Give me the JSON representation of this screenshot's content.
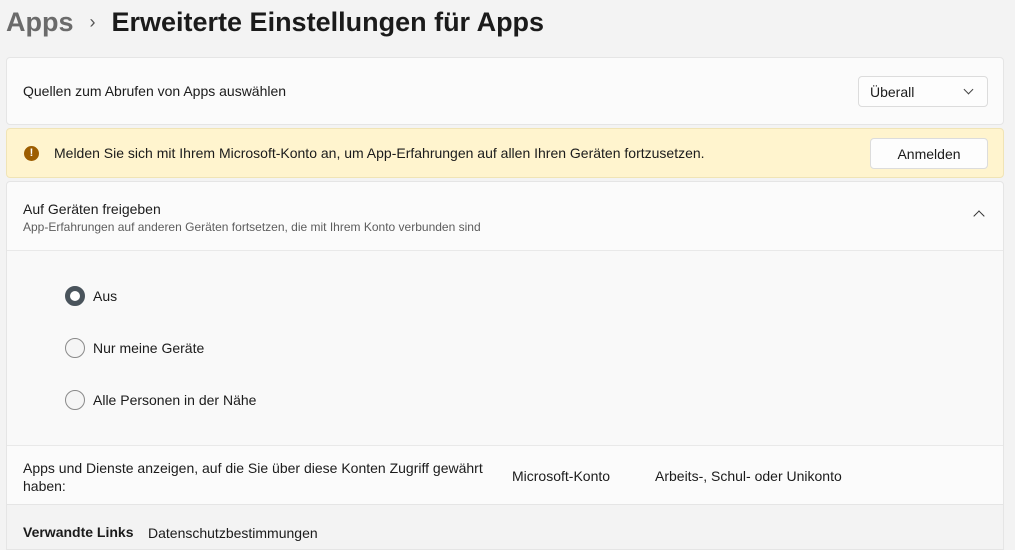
{
  "breadcrumb": {
    "parent": "Apps",
    "separator": "›",
    "current": "Erweiterte Einstellungen für Apps"
  },
  "source": {
    "label": "Quellen zum Abrufen von Apps auswählen",
    "selected": "Überall",
    "icon": "chevron-down-icon"
  },
  "warning": {
    "icon": "warning-icon",
    "icon_glyph": "!",
    "text": "Melden Sie sich mit Ihrem Microsoft-Konto an, um App-Erfahrungen auf allen Ihren Geräten fortzusetzen.",
    "button": "Anmelden",
    "color": "#fff4ce"
  },
  "share": {
    "title": "Auf Geräten freigeben",
    "subtitle": "App-Erfahrungen auf anderen Geräten fortsetzen, die mit Ihrem Konto verbunden sind",
    "expanded": true,
    "options": [
      {
        "label": "Aus",
        "checked": true
      },
      {
        "label": "Nur meine Geräte",
        "checked": false
      },
      {
        "label": "Alle Personen in der Nähe",
        "checked": false
      }
    ]
  },
  "access": {
    "label": "Apps und Dienste anzeigen, auf die Sie über diese Konten Zugriff gewährt haben:",
    "links": [
      "Microsoft-Konto",
      "Arbeits-, Schul- oder Unikonto"
    ]
  },
  "related": {
    "title": "Verwandte Links",
    "links": [
      "Datenschutzbestimmungen"
    ]
  }
}
